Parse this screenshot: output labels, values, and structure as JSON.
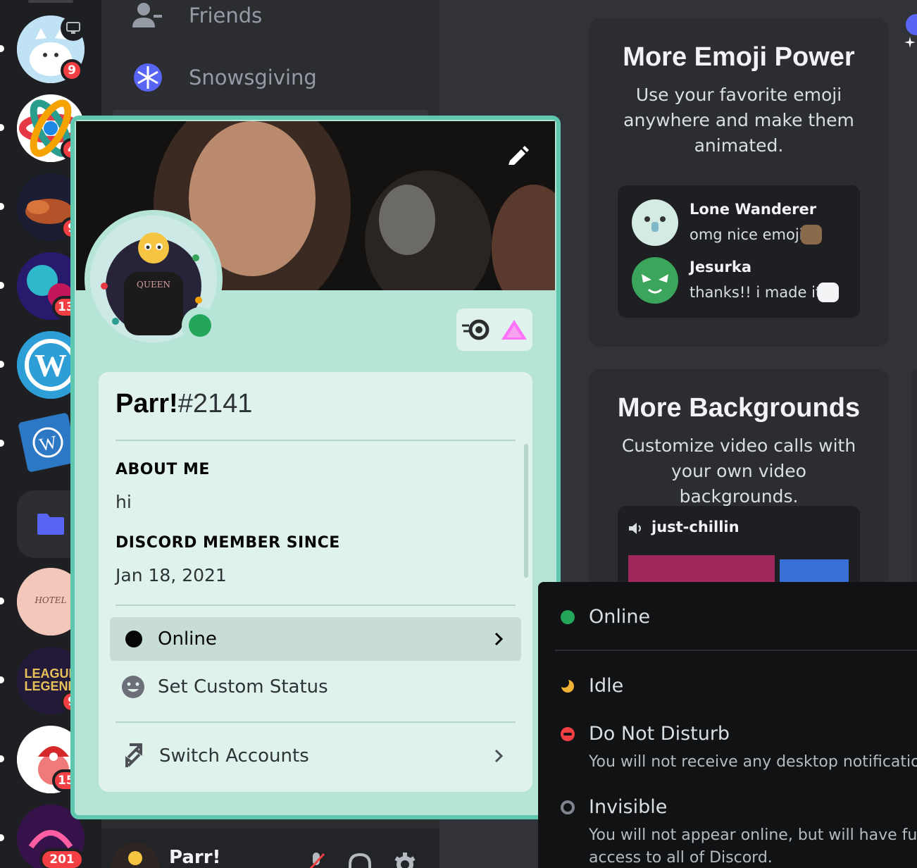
{
  "channels": {
    "friends_label": "Friends",
    "snowsgiving_label": "Snowsgiving"
  },
  "guilds": {
    "badges": [
      "9",
      "4",
      "9",
      "13",
      "9",
      "15",
      "201"
    ]
  },
  "user_bar": {
    "username": "Parr!"
  },
  "cards": {
    "emoji": {
      "title": "More Emoji Power",
      "body": "Use your favorite emoji anywhere and make them animated.",
      "messages": [
        {
          "author": "Lone Wanderer",
          "text": "omg nice emoji"
        },
        {
          "author": "Jesurka",
          "text": "thanks!! i made it!"
        }
      ]
    },
    "backgrounds": {
      "title": "More Backgrounds",
      "body": "Customize video calls with your own video backgrounds.",
      "channel": "just-chillin"
    }
  },
  "profile": {
    "username": "Parr!",
    "discriminator": "#2141",
    "about_me_header": "ABOUT ME",
    "about_me": "hi",
    "member_since_header": "DISCORD MEMBER SINCE",
    "member_since": "Jan 18, 2021",
    "status_label": "Online",
    "custom_status_label": "Set Custom Status",
    "switch_accounts_label": "Switch Accounts"
  },
  "status_menu": {
    "online": "Online",
    "idle": "Idle",
    "dnd": "Do Not Disturb",
    "dnd_desc": "You will not receive any desktop notifications.",
    "invisible": "Invisible",
    "invisible_desc": "You will not appear online, but will have full access to all of Discord."
  },
  "colors": {
    "online": "#23a55a",
    "idle": "#f0b232",
    "dnd": "#f23f43",
    "invisible": "#80848e",
    "profile_theme": "#b6e4d6",
    "profile_border": "#5ec7ad"
  }
}
